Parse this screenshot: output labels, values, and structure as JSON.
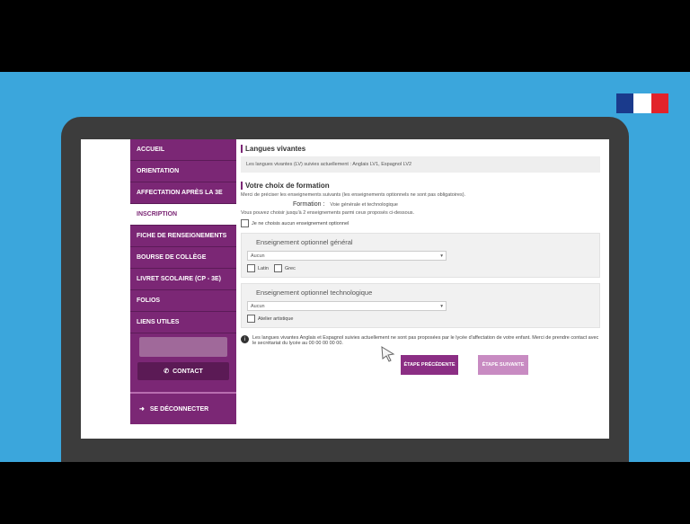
{
  "sidebar": {
    "items": [
      {
        "label": "Accueil"
      },
      {
        "label": "Orientation"
      },
      {
        "label": "Affectation après la 3e"
      },
      {
        "label": "Inscription"
      },
      {
        "label": "Fiche de renseignements"
      },
      {
        "label": "Bourse de collège"
      },
      {
        "label": "Livret scolaire (CP - 3e)"
      },
      {
        "label": "Folios"
      },
      {
        "label": "Liens utiles"
      }
    ],
    "contact_label": "Contact",
    "logout_label": "Se déconnecter"
  },
  "main": {
    "languages": {
      "title": "Langues vivantes",
      "text": "Les langues vivantes (LV) suivies actuellement : Anglais LV1, Espagnol LV2"
    },
    "formation": {
      "title": "Votre choix de formation",
      "intro": "Merci de préciser les enseignements suivants (les enseignements optionnels ne sont pas obligatoires).",
      "label": "Formation :",
      "value": "Voie générale et technologique",
      "note": "Vous pouvez choisir jusqu'à 2 enseignements parmi ceux proposés ci-dessous.",
      "no_optional": "Je ne choisis aucun enseignement optionnel"
    },
    "general": {
      "title": "Enseignement optionnel général",
      "select_value": "Aucun",
      "checkbox1": "Latin",
      "checkbox2": "Grec"
    },
    "techno": {
      "title": "Enseignement optionnel technologique",
      "select_value": "Aucun",
      "checkbox1": "Atelier artistique"
    },
    "info": "Les langues vivantes Anglais et Espagnol suivies actuellement ne sont pas proposées par le lycée d'affectation de votre enfant. Merci de prendre contact avec le secrétariat du lycée au 00 00 00 00 00.",
    "prev_label": "Étape précédente",
    "next_label": "Étape suivante"
  },
  "colors": {
    "accent": "#7b2775",
    "background": "#3ba6dc"
  }
}
